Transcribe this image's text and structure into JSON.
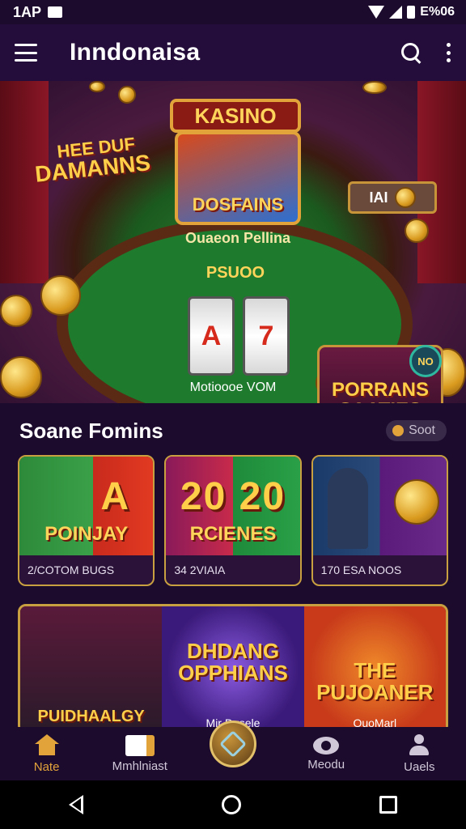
{
  "status_bar": {
    "time": "1AP",
    "battery_text": "E%06"
  },
  "app_bar": {
    "title": "Inndonaisa"
  },
  "hero": {
    "top_label": "KASINO",
    "card_title": "DOSFAINS",
    "left_badge_line1": "HEE DUF",
    "left_badge_line2": "DAMANNS",
    "sub_title": "Ouaeon Pellina",
    "score_label": "PSUOO",
    "slot_symbol_1": "A",
    "slot_symbol_2": "7",
    "caption": "Motioooe VOM",
    "right_badge": "PORRANS SAATIES",
    "chip_badge": "NO",
    "sign_text": "IAI"
  },
  "section": {
    "title": "Soane Fomins",
    "sort_label": "Soot"
  },
  "game_cards": [
    {
      "art_title": "POINJAY",
      "art_big": "A",
      "caption": "2/COTOM BUGS"
    },
    {
      "art_title": "RCIENES",
      "art_big": "20 20",
      "caption": "34 2VIAIA"
    },
    {
      "art_title": "",
      "art_big": "",
      "caption": "170 ESA NOOS"
    }
  ],
  "promo_banner": {
    "seg1_title": "PUIDHAALGY",
    "seg2_title": "DHDANG OPPHIANS",
    "seg2_caption": "Mir Dusele",
    "seg3_title": "THE PUJOANER",
    "seg3_caption": "QuoMarl"
  },
  "bottom_nav": {
    "items": [
      {
        "label": "Nate",
        "icon": "home-icon",
        "active": true
      },
      {
        "label": "Mmhlniast",
        "icon": "card-icon",
        "active": false
      },
      {
        "label": "",
        "icon": "center-fab-icon",
        "active": false
      },
      {
        "label": "Meodu",
        "icon": "eye-icon",
        "active": false
      },
      {
        "label": "Uaels",
        "icon": "user-icon",
        "active": false
      }
    ]
  },
  "colors": {
    "background": "#1d0b2e",
    "accent": "#e2a33a",
    "card_border": "#c8a040"
  }
}
